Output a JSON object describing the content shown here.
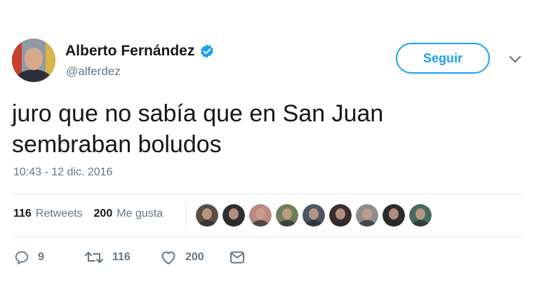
{
  "author": {
    "name": "Alberto Fernández",
    "handle": "@alferdez",
    "verified": true
  },
  "follow_button": {
    "label": "Seguir"
  },
  "tweet": {
    "text": "juro que no sabía que en San Juan\nsembraban boludos",
    "timestamp": "10:43 - 12 dic. 2016"
  },
  "stats": {
    "retweets_count": "116",
    "retweets_label": "Retweets",
    "likes_count": "200",
    "likes_label": "Me gusta"
  },
  "liker_avatars": [
    {
      "bg": "#5a4f47"
    },
    {
      "bg": "#2f2f33"
    },
    {
      "bg": "#b98a82"
    },
    {
      "bg": "#6e7d5a"
    },
    {
      "bg": "#4b5460"
    },
    {
      "bg": "#3a2b2e"
    },
    {
      "bg": "#8c8c8c"
    },
    {
      "bg": "#2b2b2b"
    },
    {
      "bg": "#4a6a5e"
    }
  ],
  "actions": {
    "reply_count": "9",
    "retweet_count": "116",
    "like_count": "200"
  },
  "colors": {
    "accent": "#1da1f2",
    "text": "#14171a",
    "muted": "#657786",
    "divider": "#e1e8ed"
  },
  "icons": [
    "verified-badge-icon",
    "chevron-down-icon",
    "reply-icon",
    "retweet-icon",
    "heart-icon",
    "message-icon"
  ]
}
